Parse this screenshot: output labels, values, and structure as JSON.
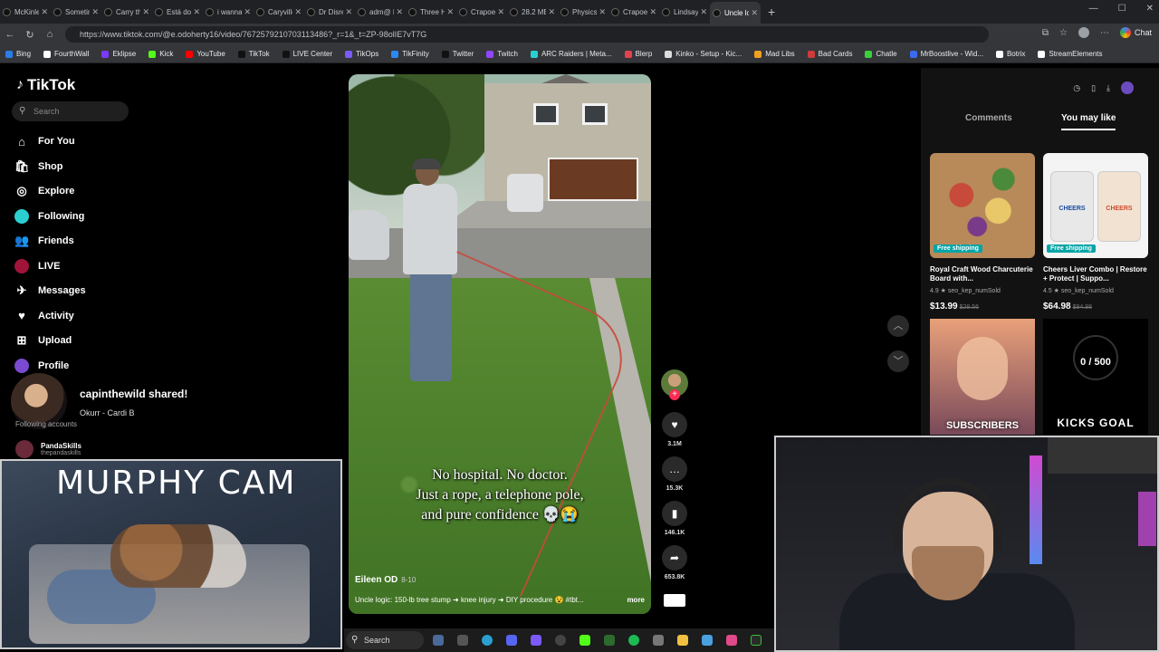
{
  "browser": {
    "tabs": [
      {
        "label": "McKinley c",
        "active": false
      },
      {
        "label": "Sometimes",
        "active": false
      },
      {
        "label": "Carry the d",
        "active": false
      },
      {
        "label": "Está dormi",
        "active": false
      },
      {
        "label": "i wanna talk",
        "active": false
      },
      {
        "label": "Caryville Fl",
        "active": false
      },
      {
        "label": "Dr Disrespe",
        "active": false
      },
      {
        "label": "adm@ Ша",
        "active": false
      },
      {
        "label": "Three Hard",
        "active": false
      },
      {
        "label": "Старое вид",
        "active": false
      },
      {
        "label": "28.2 METER",
        "active": false
      },
      {
        "label": "Physics: Cli",
        "active": false
      },
      {
        "label": "Старое вид",
        "active": false
      },
      {
        "label": "Lindsay Cla",
        "active": false
      },
      {
        "label": "Uncle logic",
        "active": true
      }
    ],
    "url": "https://www.tiktok.com/@e.odoherty16/video/7672579210703113486?_r=1&_t=ZP-98olIE7vT7G",
    "chat_label": "Chat",
    "bookmarks": [
      {
        "label": "Bing",
        "color": "#2b7de9"
      },
      {
        "label": "FourthWall",
        "color": "#ffffff"
      },
      {
        "label": "Eklipse",
        "color": "#7a3aff"
      },
      {
        "label": "Kick",
        "color": "#53fc18"
      },
      {
        "label": "YouTube",
        "color": "#ff0000"
      },
      {
        "label": "TikTok",
        "color": "#111111"
      },
      {
        "label": "LIVE Center",
        "color": "#111111"
      },
      {
        "label": "TikOps",
        "color": "#7a5af8"
      },
      {
        "label": "TikFinity",
        "color": "#2a8af0"
      },
      {
        "label": "Twitter",
        "color": "#111111"
      },
      {
        "label": "Twitch",
        "color": "#9146ff"
      },
      {
        "label": "ARC Raiders | Meta...",
        "color": "#2ad0d0"
      },
      {
        "label": "Blerp",
        "color": "#e0434f"
      },
      {
        "label": "Kinko - Setup - Kic...",
        "color": "#dddddd"
      },
      {
        "label": "Mad Libs",
        "color": "#f0a020"
      },
      {
        "label": "Bad Cards",
        "color": "#d03a3a"
      },
      {
        "label": "Chatle",
        "color": "#3ad03a"
      },
      {
        "label": "MrBoostlive - Wid...",
        "color": "#3a6af0"
      },
      {
        "label": "Botrix",
        "color": "#ffffff"
      },
      {
        "label": "StreamElements",
        "color": "#ffffff"
      }
    ]
  },
  "tiktok": {
    "logo": "TikTok",
    "search_placeholder": "Search",
    "nav": [
      {
        "label": "For You",
        "icon": "home-icon"
      },
      {
        "label": "Shop",
        "icon": "shop-icon"
      },
      {
        "label": "Explore",
        "icon": "compass-icon"
      },
      {
        "label": "Following",
        "icon": "following-avatar-icon"
      },
      {
        "label": "Friends",
        "icon": "friends-icon"
      },
      {
        "label": "LIVE",
        "icon": "live-icon"
      },
      {
        "label": "Messages",
        "icon": "messages-icon"
      },
      {
        "label": "Activity",
        "icon": "bell-icon"
      },
      {
        "label": "Upload",
        "icon": "plus-square-icon"
      },
      {
        "label": "Profile",
        "icon": "profile-icon"
      }
    ],
    "shared": {
      "user": "capinthewild shared!",
      "song": "Okurr - Cardi B"
    },
    "following_label": "Following accounts",
    "following_accounts": [
      {
        "name": "PandaSkills",
        "handle": "thepandaskills"
      }
    ],
    "video": {
      "caption_lines": [
        "No hospital. No doctor.",
        "Just a rope, a telephone pole,",
        "and pure confidence 💀😭"
      ],
      "author": "Eileen OD",
      "date": "8-10",
      "description": "Uncle logic: 150-lb tree stump ➜ knee injury ➜ DIY procedure 😵 #tbt...",
      "more_label": "more"
    },
    "actions": [
      {
        "name": "like",
        "icon": "heart-icon",
        "count": "3.1M"
      },
      {
        "name": "comment",
        "icon": "comment-icon",
        "count": "15.3K"
      },
      {
        "name": "save",
        "icon": "bookmark-icon",
        "count": "146.1K"
      },
      {
        "name": "share",
        "icon": "share-icon",
        "count": "653.8K"
      }
    ],
    "right_panel": {
      "tabs": [
        {
          "label": "Comments",
          "active": false
        },
        {
          "label": "You may like",
          "active": true
        }
      ],
      "products": [
        {
          "badge": "Free shipping",
          "title": "Royal Craft Wood Charcuterie Board with...",
          "rating": "4.9 ★",
          "sold": "seo_kep_numSold",
          "price": "$13.99",
          "old_price": "$28.56"
        },
        {
          "badge": "Free shipping",
          "title": "Cheers Liver Combo | Restore + Protect | Suppo...",
          "rating": "4.5 ★",
          "sold": "seo_kep_numSold",
          "price": "$64.98",
          "old_price": "$94.98",
          "jar_label": "CHEERS"
        }
      ]
    }
  },
  "overlays": {
    "murphy_cam_title": "MURPHY CAM",
    "subscribers_label": "SUBSCRIBERS",
    "kicks_goal_count": "0 / 500",
    "kicks_goal_label": "KICKS GOAL"
  },
  "taskbar": {
    "search_label": "Search"
  }
}
